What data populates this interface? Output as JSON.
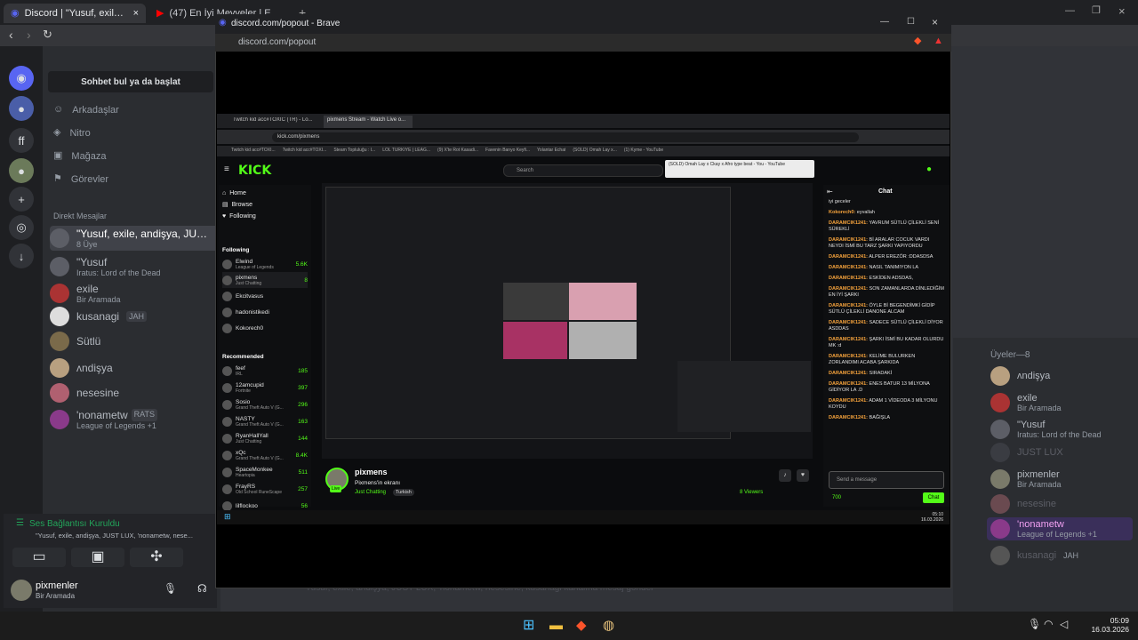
{
  "tabs": [
    {
      "label": "Discord | \"Yusuf, exile, andişya, JUST LUX...",
      "icon": "discord-icon"
    },
    {
      "label": "(47) En İyi Meyveler | Eşleşmeye Başl...",
      "icon": "youtube-icon"
    }
  ],
  "discord": {
    "search_placeholder": "Sohbet bul ya da başlat",
    "nav": [
      "Arkadaşlar",
      "Nitro",
      "Mağaza",
      "Görevler"
    ],
    "dm_header": "Direkt Mesajlar",
    "dms": [
      {
        "name": "\"Yusuf, exile, andişya, JUST LUX...",
        "sub": "8 Üye"
      },
      {
        "name": "\"Yusuf",
        "sub": "Iratus: Lord of the Dead"
      },
      {
        "name": "exile",
        "sub": "Bir Aramada"
      },
      {
        "name": "kusanagi",
        "sub": "JAH"
      },
      {
        "name": "Sütlü",
        "sub": ""
      },
      {
        "name": "ᴧndişya",
        "sub": ""
      },
      {
        "name": "nesesine",
        "sub": ""
      },
      {
        "name": "'nonametw",
        "sub": "League of Legends +1"
      },
      {
        "name": "RATS",
        "sub": ""
      }
    ],
    "voice": {
      "title": "Ses Bağlantısı Kuruldu",
      "channel": "\"Yusuf, exile, andişya, JUST LUX, 'nonametw, nese..."
    },
    "user": {
      "name": "pixmenler",
      "status": "Bir Aramada"
    },
    "composer_placeholder": "\"Yusuf, exile, andişya, JUST LUX, 'nonametw, nesesine, kusanagi kanalına mesaj gönder",
    "members_header": "Üyeler—8",
    "members": [
      {
        "name": "ᴧndişya",
        "sub": ""
      },
      {
        "name": "exile",
        "sub": "Bir Aramada"
      },
      {
        "name": "\"Yusuf",
        "sub": "Iratus: Lord of the Dead"
      },
      {
        "name": "JUST LUX",
        "sub": ""
      },
      {
        "name": "pixmenler",
        "sub": "Bir Aramada"
      },
      {
        "name": "nesesine",
        "sub": ""
      },
      {
        "name": "'nonametw",
        "sub": "League of Legends +1"
      },
      {
        "name": "kusanagi",
        "sub": "JAH"
      }
    ]
  },
  "popout": {
    "title": "discord.com/popout - Brave",
    "url": "discord.com/popout"
  },
  "inner_browser": {
    "tabs": [
      "Twitch kid acc#TOXIC (TR) - Lo...",
      "pixmens Stream - Watch Live o..."
    ],
    "url": "kick.com/pixmens",
    "bookmarks": [
      "Twitch kid acc#TOXI...",
      "Twitch kid acc#TOXI...",
      "Steam Topluluğu : I...",
      "LOL TÜRKİYE | LEAG...",
      "(9) X'te Rot Kasadi...",
      "Favenin Banyo Keyfi...",
      "Yolantar Echat",
      "(SOLD) Omah Lay x...",
      "(1) Kyme - YouTube"
    ],
    "tooltip": "(SOLD) Omah Lay x Ckay x Afro type beat - You - YouTube",
    "search_placeholder": "Search",
    "kick_nav": [
      "Home",
      "Browse",
      "Following"
    ],
    "following_header": "Following",
    "following": [
      {
        "name": "Elwind",
        "game": "League of Legends",
        "viewers": "5.6K"
      },
      {
        "name": "pixmens",
        "game": "Just Chatting",
        "viewers": "8"
      },
      {
        "name": "Ekcitvasus",
        "game": "",
        "viewers": ""
      },
      {
        "name": "hadonistikedi",
        "game": "",
        "viewers": ""
      },
      {
        "name": "Kokorech0",
        "game": "",
        "viewers": ""
      }
    ],
    "recommended_header": "Recommended",
    "recommended": [
      {
        "name": "feef",
        "game": "IRL",
        "viewers": "185"
      },
      {
        "name": "12amcupid",
        "game": "Fortnite",
        "viewers": "397"
      },
      {
        "name": "Sosio",
        "game": "Grand Theft Auto V (G...",
        "viewers": "296"
      },
      {
        "name": "NASTY",
        "game": "Grand Theft Auto V (G...",
        "viewers": "163"
      },
      {
        "name": "RyanHallYall",
        "game": "Just Chatting",
        "viewers": "144"
      },
      {
        "name": "xQc",
        "game": "Grand Theft Auto V (G...",
        "viewers": "8.4K"
      },
      {
        "name": "SpaceMonkee",
        "game": "Heartopia",
        "viewers": "511"
      },
      {
        "name": "FrayRS",
        "game": "Old School RuneScape",
        "viewers": "257"
      },
      {
        "name": "lilflockoo",
        "game": "",
        "viewers": "56"
      }
    ],
    "stream": {
      "name": "pixmens",
      "subtitle": "Pixmens'in ekranı",
      "category": "Just Chatting",
      "tag": "Turkish",
      "viewers": "8 Viewers",
      "live": "Live"
    },
    "chat_title": "Chat",
    "chat": [
      {
        "user": "",
        "text": "iyi geceler"
      },
      {
        "user": "Kokorech0:",
        "text": "eyvallah"
      },
      {
        "user": "DARAMCIK1241:",
        "text": "YAVRUM SÜTLÜ ÇİLEKLİ SENİ SÜREKLİ"
      },
      {
        "user": "DARAMCIK1241:",
        "text": "Bİ ARALAR COCUK VARDI NEYDI İSMİ BU TARZ ŞARKI YAPIYORDU"
      },
      {
        "user": "DARAMCIK1241:",
        "text": "ALPER EREZÖR :DDASDSA"
      },
      {
        "user": "DARAMCIK1241:",
        "text": "NASIL TANIMIYON LA"
      },
      {
        "user": "DARAMCIK1241:",
        "text": "ESKİDEN ADSDAS,"
      },
      {
        "user": "DARAMCIK1241:",
        "text": "SON ZAMANLARDA DİNLEDİĞİM EN İYİ ŞARKI"
      },
      {
        "user": "DARAMCIK1241:",
        "text": "ÖYLE Bİ BEGENDİMKİ GİDİP SÜTLÜ ÇİLEKLİ DANONE ALCAM"
      },
      {
        "user": "DARAMCIK1241:",
        "text": "SADECE SÜTLÜ ÇİLEKLİ DİYOR ASDDAS"
      },
      {
        "user": "DARAMCIK1241:",
        "text": "ŞARKI İSMİ BU KADAR OLURDU MK :d"
      },
      {
        "user": "DARAMCIK1241:",
        "text": "KELİME BULURKEN ZORLANDIMI ACABA ŞARKIDA"
      },
      {
        "user": "DARAMCIK1241:",
        "text": "SIRADAKİ"
      },
      {
        "user": "DARAMCIK1241:",
        "text": "ENES BATUR 13 MİLYONA GİDİYOR LA .D"
      },
      {
        "user": "DARAMCIK1241:",
        "text": "ADAM 1 VİDEODA 3 MİLYONU KOYDU"
      },
      {
        "user": "DARAMCIK1241:",
        "text": "BAĞIŞLA"
      }
    ],
    "chat_placeholder": "Send a message",
    "chat_button": "Chat",
    "points": "700",
    "clock": {
      "time": "05:10",
      "date": "16.03.2026"
    }
  },
  "taskbar": {
    "time": "05:09",
    "date": "16.03.2026"
  },
  "colors": {
    "kick_green": "#53fc18",
    "discord_blurple": "#5865f2",
    "chat_user": "#f6a33c"
  }
}
